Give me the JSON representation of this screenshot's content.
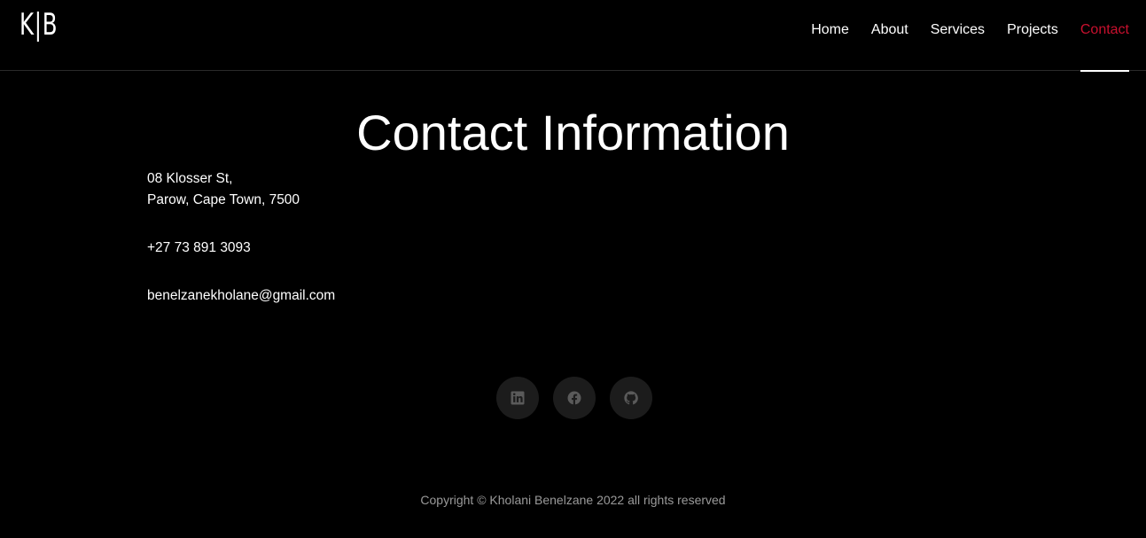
{
  "header": {
    "logo": "K|B",
    "nav": [
      {
        "label": "Home"
      },
      {
        "label": "About"
      },
      {
        "label": "Services"
      },
      {
        "label": "Projects"
      },
      {
        "label": "Contact"
      }
    ],
    "active_nav": "Contact",
    "accent_color": "#c8102e"
  },
  "main": {
    "title": "Contact Information",
    "address_line1": "08 Klosser St,",
    "address_line2": "Parow, Cape Town, 7500",
    "phone": "+27 73 891 3093",
    "email": "benelzanekholane@gmail.com"
  },
  "socials": [
    {
      "icon": "linkedin-icon"
    },
    {
      "icon": "facebook-icon"
    },
    {
      "icon": "github-icon"
    }
  ],
  "footer": {
    "copyright": "Copyright © Kholani Benelzane 2022 all rights reserved"
  }
}
